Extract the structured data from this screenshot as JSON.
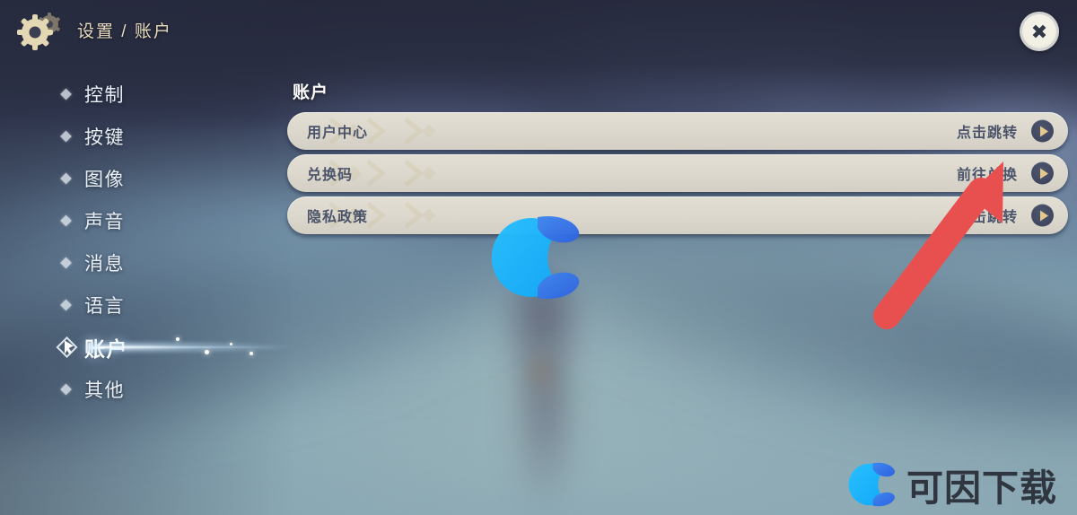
{
  "header": {
    "gear_icon": "gear-icon",
    "breadcrumb": "设置 / 账户",
    "breadcrumb_parts": [
      "设置",
      "/",
      "账户"
    ],
    "close_icon": "close-icon",
    "close_label": "✕"
  },
  "sidebar": {
    "items": [
      {
        "label": "控制",
        "selected": false
      },
      {
        "label": "按键",
        "selected": false
      },
      {
        "label": "图像",
        "selected": false
      },
      {
        "label": "声音",
        "selected": false
      },
      {
        "label": "消息",
        "selected": false
      },
      {
        "label": "语言",
        "selected": false
      },
      {
        "label": "账户",
        "selected": true
      },
      {
        "label": "其他",
        "selected": false
      }
    ]
  },
  "panel": {
    "title": "账户",
    "rows": [
      {
        "label": "用户中心",
        "action": "点击跳转",
        "arrow_icon": "chevron-right-icon"
      },
      {
        "label": "兑换码",
        "action": "前往兑换",
        "arrow_icon": "chevron-right-icon"
      },
      {
        "label": "隐私政策",
        "action": "点击跳转",
        "arrow_icon": "chevron-right-icon"
      }
    ]
  },
  "watermarks": {
    "center_logo": "c-logo-icon",
    "corner_logo": "c-logo-icon",
    "corner_text": "可因下载"
  },
  "annotation": {
    "arrow_color": "#e8504f",
    "points_to": "兑换码 前往兑换"
  },
  "colors": {
    "header_bg": "#2b2e42",
    "breadcrumb_text": "#e8dcbe",
    "row_bg": "#ded9ce",
    "row_text": "#4c546b",
    "arrow_circle": "#3f4560",
    "arrow_glyph": "#e3c98a",
    "selected_text": "#ffffff",
    "sidebar_text": "#e9eef3",
    "annotation_red": "#e8504f",
    "logo_cyan": "#2fb8f5",
    "logo_blue": "#2f72e8"
  }
}
